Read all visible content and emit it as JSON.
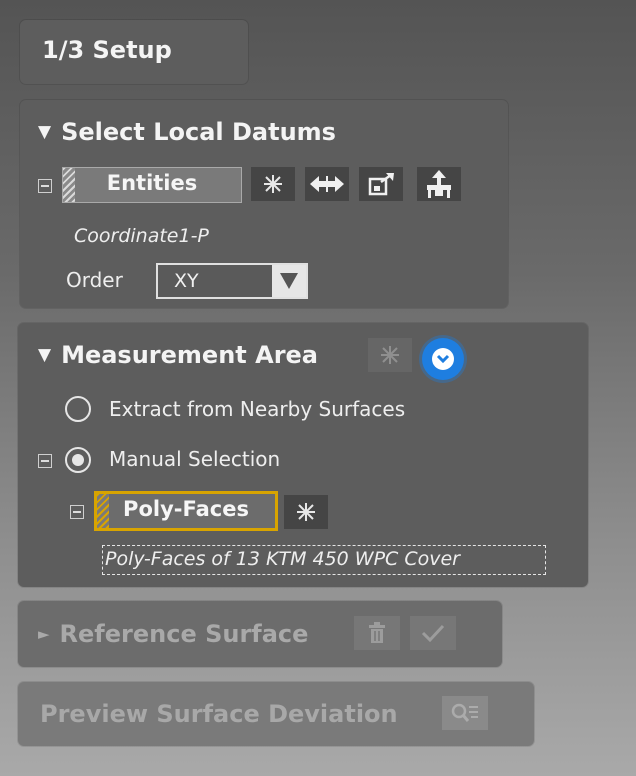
{
  "setup": {
    "title": "1/3 Setup"
  },
  "datums": {
    "title": "Select Local Datums",
    "entity_button": "Entities",
    "entity_value": "Coordinate1-P",
    "order_label": "Order",
    "order_value": "XY"
  },
  "measurement": {
    "title": "Measurement Area",
    "option_extract": "Extract from Nearby Surfaces",
    "option_manual": "Manual Selection",
    "selected_option": "Manual Selection",
    "polyfaces_button": "Poly-Faces",
    "polyfaces_value": "Poly-Faces of 13 KTM 450 WPC Cover"
  },
  "reference": {
    "title": "Reference Surface"
  },
  "preview": {
    "title": "Preview Surface Deviation"
  },
  "colors": {
    "accent_blue": "#1e7ee0",
    "highlight_gold": "#d8a400",
    "panel": "#5d5d5d"
  },
  "icons": {
    "entities_tools": [
      "clear-selection-icon",
      "flip-direction-icon",
      "export-icon",
      "place-datum-icon"
    ],
    "measurement_tools": [
      "clear-selection-icon",
      "collapse-chevron-icon"
    ],
    "polyfaces_tools": [
      "clear-selection-icon"
    ],
    "reference_tools": [
      "trash-icon",
      "checkmark-icon"
    ],
    "preview_tools": [
      "preview-icon"
    ]
  }
}
